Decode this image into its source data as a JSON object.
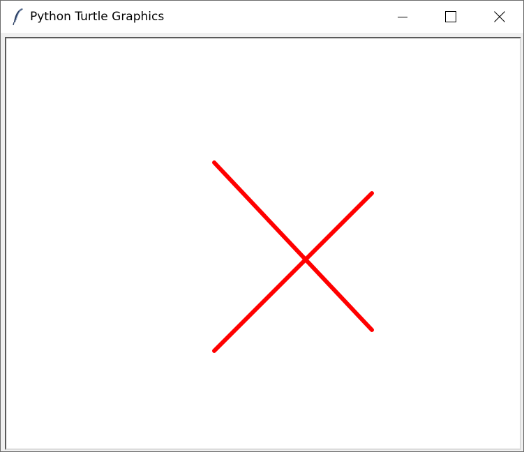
{
  "window": {
    "title": "Python Turtle Graphics",
    "app_icon": "feather-icon",
    "controls": {
      "minimize_icon": "minimize-icon",
      "maximize_icon": "maximize-icon",
      "close_icon": "close-icon"
    }
  },
  "canvas": {
    "background": "#ffffff",
    "pen_color": "#ff0000"
  }
}
